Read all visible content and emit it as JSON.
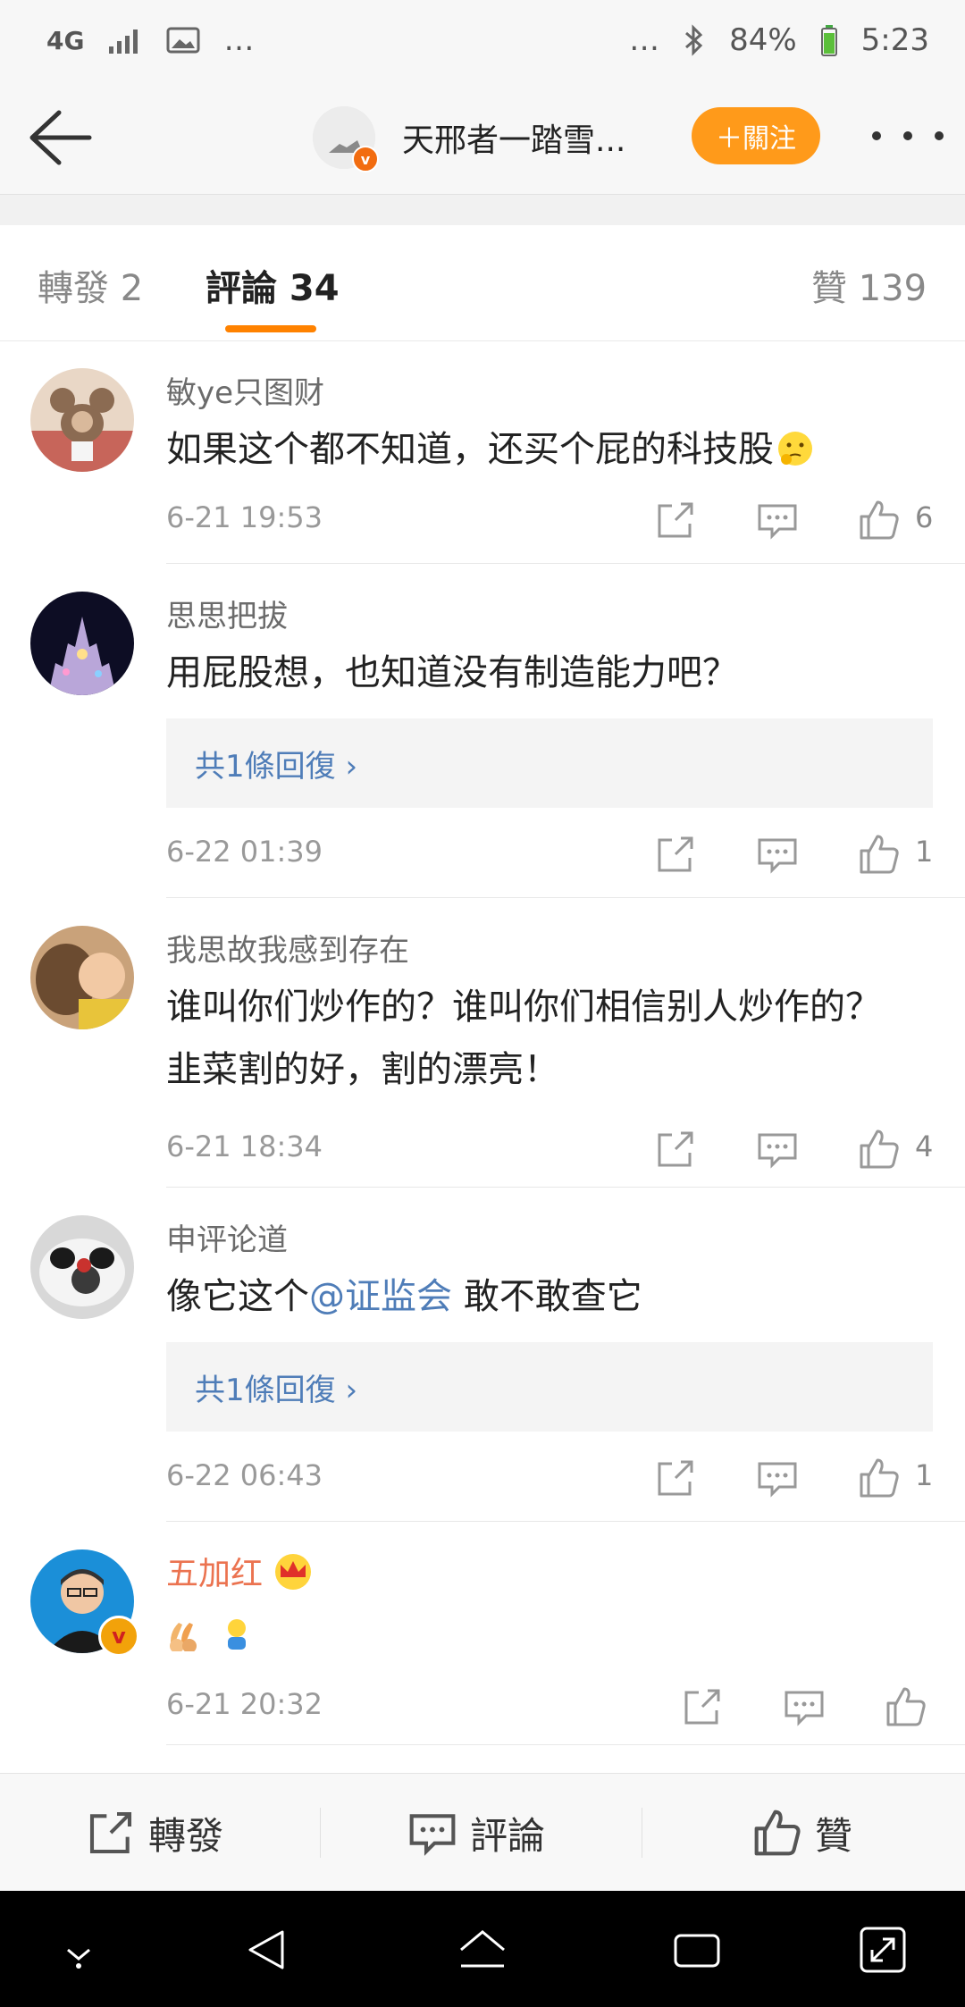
{
  "status": {
    "net": "4G",
    "more": "…",
    "more_right": "…",
    "battery": "84%",
    "time": "5:23"
  },
  "header": {
    "title": "天邢者一踏雪...",
    "follow_label": "＋關注"
  },
  "tabs": {
    "repost": "轉發 2",
    "comments": "評論 34",
    "likes": "贊 139"
  },
  "comments": [
    {
      "name": "敏ye只图财",
      "text": "如果这个都不知道，还买个屁的科技股",
      "time": "6-21 19:53",
      "likes": "6"
    },
    {
      "name": "思思把拔",
      "text": "用屁股想，也知道没有制造能力吧？",
      "reply": "共1條回復 ›",
      "time": "6-22 01:39",
      "likes": "1"
    },
    {
      "name": "我思故我感到存在",
      "text": "谁叫你们炒作的？谁叫你们相信别人炒作的？韭菜割的好，割的漂亮！",
      "time": "6-21 18:34",
      "likes": "4"
    },
    {
      "name": "申评论道",
      "text_before": "像它这个",
      "mention": "@证监会",
      "text_after": " 敢不敢查它",
      "reply": "共1條回復 ›",
      "time": "6-22 06:43",
      "likes": "1"
    },
    {
      "name": "五加红",
      "text": "",
      "time": "6-21 20:32"
    }
  ],
  "bottom": {
    "repost": "轉發",
    "comment": "評論",
    "like": "贊"
  },
  "colors": {
    "accent": "#ff8200",
    "link": "#4f7db8",
    "follow": "#ff9a1a"
  }
}
